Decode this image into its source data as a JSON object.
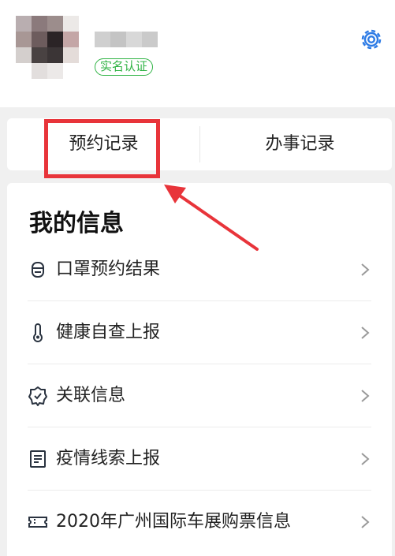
{
  "profile": {
    "verify_badge": "实名认证",
    "settings_icon": "gear-icon"
  },
  "tabs": {
    "appointment": "预约记录",
    "affairs": "办事记录"
  },
  "info": {
    "title": "我的信息",
    "items": [
      {
        "label": "口罩预约结果",
        "icon": "mask-icon"
      },
      {
        "label": "健康自查上报",
        "icon": "thermometer-icon"
      },
      {
        "label": "关联信息",
        "icon": "badge-check-icon"
      },
      {
        "label": "疫情线索上报",
        "icon": "document-lines-icon"
      },
      {
        "label": "2020年广州国际车展购票信息",
        "icon": "ticket-icon"
      }
    ]
  },
  "colors": {
    "accent_blue": "#2d7be5",
    "verify_green": "#2fb344",
    "annotation_red": "#e8343a"
  }
}
